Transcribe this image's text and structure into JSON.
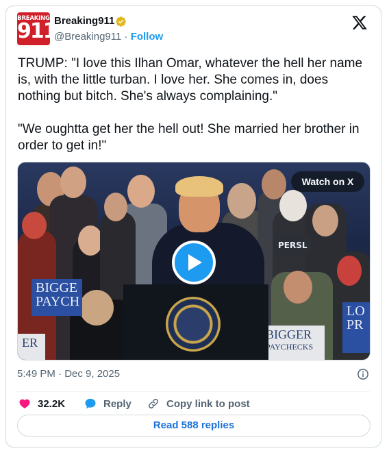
{
  "author": {
    "avatar_text_top": "BREAKING",
    "avatar_text_main": "911",
    "display_name": "Breaking911",
    "handle": "@Breaking911",
    "separator": " · ",
    "follow_label": "Follow"
  },
  "tweet": {
    "text": "TRUMP: \"I love this Ilhan Omar, whatever the hell her name is, with the little turban. I love her. She comes in, does nothing but bitch. She's always complaining.\"\n\n\"We oughtta get her the hell out! She married her brother in order to get in!\""
  },
  "media": {
    "watch_label": "Watch on X",
    "sign_left_1": "BIGGE",
    "sign_left_2": "PAYCH",
    "sign_center_1": "BIGGER",
    "sign_center_2": "PAYCHECKS",
    "sign_right_1": "LO",
    "sign_right_2": "PR",
    "sign_bottom_left": "ER",
    "sign_persl": "PERSL"
  },
  "timestamp": "5:49 PM · Dec 9, 2025",
  "actions": {
    "likes": "32.2K",
    "reply_label": "Reply",
    "copy_label": "Copy link to post"
  },
  "read_replies_label": "Read 588 replies",
  "colors": {
    "accent": "#1d9bf0",
    "like": "#f91880",
    "brand_red": "#d0202a"
  }
}
